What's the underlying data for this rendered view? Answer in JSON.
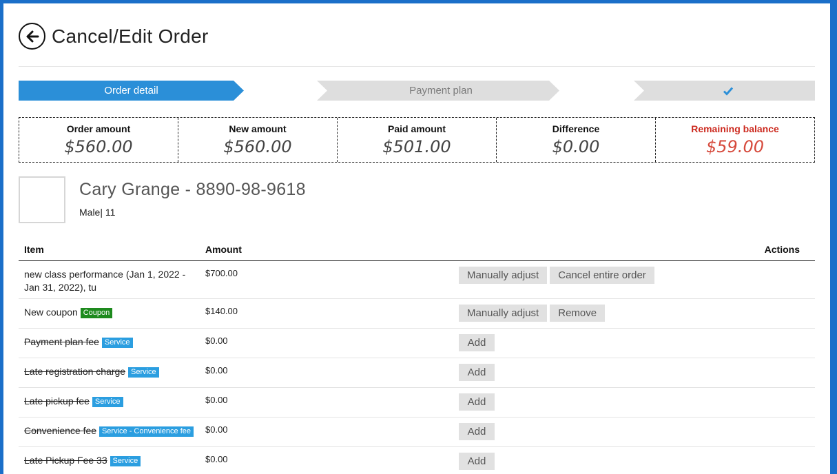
{
  "header": {
    "title": "Cancel/Edit Order",
    "back_icon": "arrow-left-circle-icon"
  },
  "stepper": {
    "steps": [
      {
        "label": "Order detail",
        "state": "active"
      },
      {
        "label": "Payment plan",
        "state": "inactive"
      },
      {
        "label": "",
        "icon": "checkmark-icon",
        "state": "inactive"
      }
    ]
  },
  "summary": {
    "order_amount": {
      "label": "Order amount",
      "value": "$560.00"
    },
    "new_amount": {
      "label": "New amount",
      "value": "$560.00"
    },
    "paid_amount": {
      "label": "Paid amount",
      "value": "$501.00"
    },
    "difference": {
      "label": "Difference",
      "value": "$0.00"
    },
    "remaining_balance": {
      "label": "Remaining balance",
      "value": "$59.00"
    }
  },
  "customer": {
    "name": "Cary Grange - 8890-98-9618",
    "meta": "Male| 11"
  },
  "table": {
    "headers": {
      "item": "Item",
      "amount": "Amount",
      "actions": "Actions"
    },
    "rows": [
      {
        "item": "new class performance (Jan 1, 2022 - Jan 31, 2022), tu",
        "badge": "",
        "amount": "$700.00",
        "actions": [
          "Manually adjust",
          "Cancel entire order"
        ]
      },
      {
        "item": "New coupon",
        "badge": "Coupon",
        "amount": "$140.00",
        "actions": [
          "Manually adjust",
          "Remove"
        ]
      },
      {
        "item": "Payment plan fee",
        "badge": "Service",
        "amount": "$0.00",
        "actions": [
          "Add"
        ]
      },
      {
        "item": "Late registration charge",
        "badge": "Service",
        "amount": "$0.00",
        "actions": [
          "Add"
        ]
      },
      {
        "item": "Late pickup fee",
        "badge": "Service",
        "amount": "$0.00",
        "actions": [
          "Add"
        ]
      },
      {
        "item": "Convenience fee",
        "badge": "Service - Convenience fee",
        "amount": "$0.00",
        "actions": [
          "Add"
        ]
      },
      {
        "item": "Late Pickup Fee 33",
        "badge": "Service",
        "amount": "$0.00",
        "actions": [
          "Add"
        ]
      }
    ]
  },
  "colors": {
    "active_step": "#2b8fd8",
    "inactive_step": "#dedede",
    "remaining_balance": "#cc2a1f",
    "coupon_badge": "#1e8a1e",
    "service_badge": "#2b9ee0",
    "window_border": "#1b6fc9"
  }
}
